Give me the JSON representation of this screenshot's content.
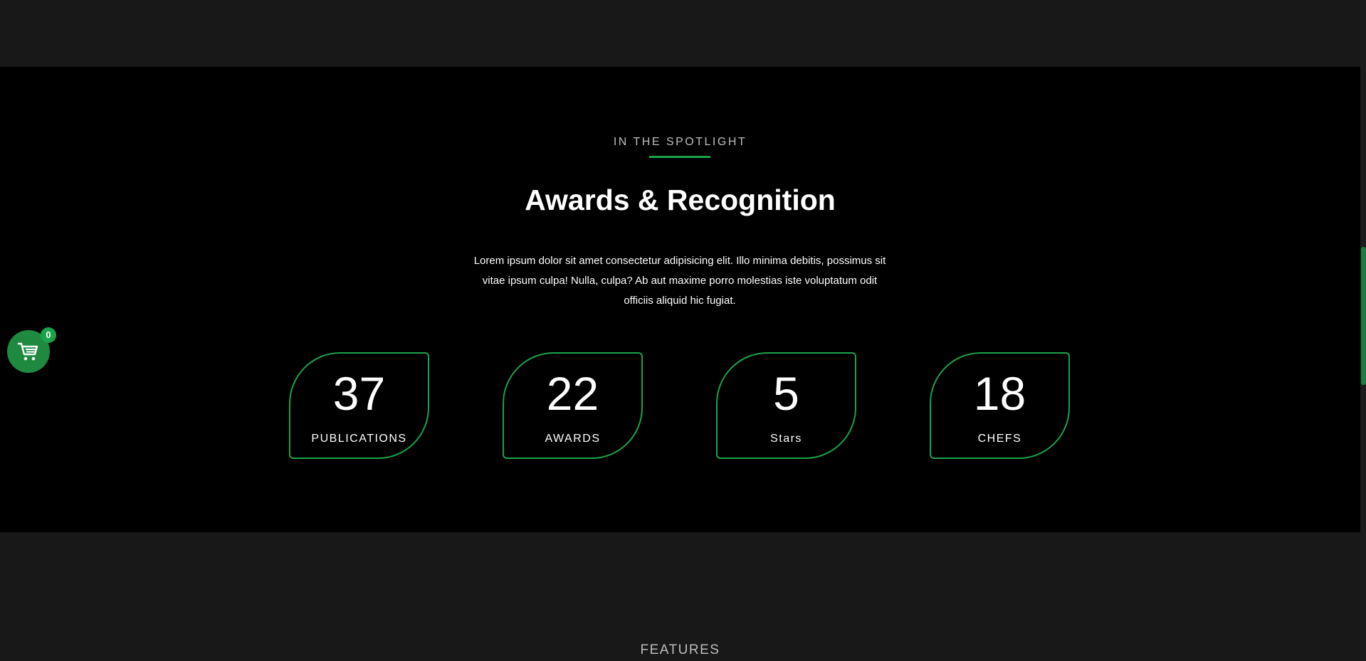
{
  "spotlight": {
    "eyebrow": "IN THE SPOTLIGHT",
    "heading": "Awards & Recognition",
    "lead": "Lorem ipsum dolor sit amet consectetur adipisicing elit. Illo minima debitis, possimus sit vitae ipsum culpa! Nulla, culpa? Ab aut maxime porro molestias iste voluptatum odit officiis aliquid hic fugiat.",
    "stats": [
      {
        "value": "37",
        "label": "PUBLICATIONS"
      },
      {
        "value": "22",
        "label": "AWARDS"
      },
      {
        "value": "5",
        "label": "Stars"
      },
      {
        "value": "18",
        "label": "CHEFS"
      }
    ]
  },
  "features": {
    "eyebrow": "FEATURES"
  },
  "cart": {
    "icon": "cart-icon",
    "count": "0"
  },
  "colors": {
    "accent": "#1aa34a",
    "section_dark": "#000000",
    "section_light": "#181818",
    "muted_text": "#bdbdbd"
  }
}
